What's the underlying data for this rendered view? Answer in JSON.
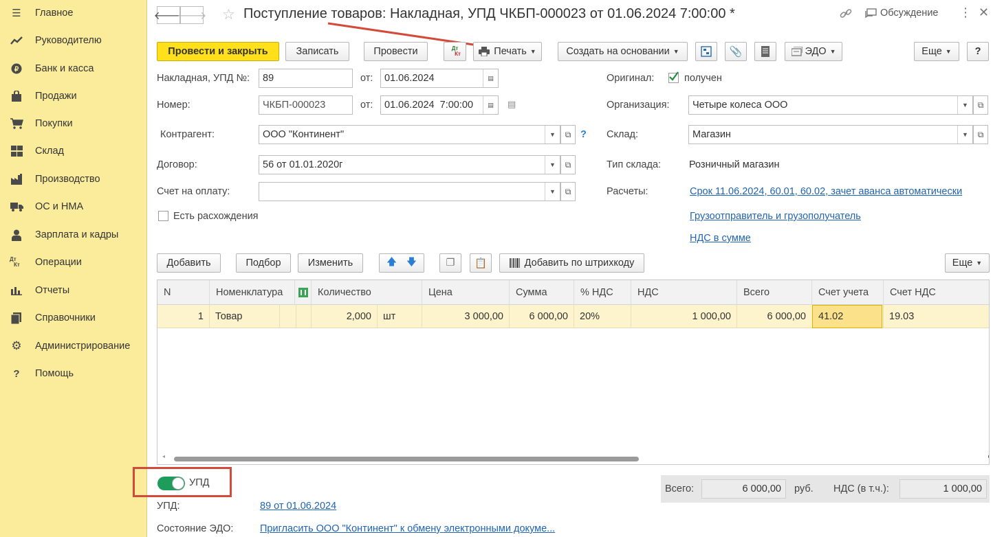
{
  "sidebar": {
    "items": [
      {
        "label": "Главное",
        "icon": "menu-icon"
      },
      {
        "label": "Руководителю",
        "icon": "trend-icon"
      },
      {
        "label": "Банк и касса",
        "icon": "coin-icon"
      },
      {
        "label": "Продажи",
        "icon": "bag-icon"
      },
      {
        "label": "Покупки",
        "icon": "cart-icon"
      },
      {
        "label": "Склад",
        "icon": "grid-icon"
      },
      {
        "label": "Производство",
        "icon": "factory-icon"
      },
      {
        "label": "ОС и НМА",
        "icon": "truck-icon"
      },
      {
        "label": "Зарплата и кадры",
        "icon": "person-icon"
      },
      {
        "label": "Операции",
        "icon": "dt-kt-icon"
      },
      {
        "label": "Отчеты",
        "icon": "bar-chart-icon"
      },
      {
        "label": "Справочники",
        "icon": "books-icon"
      },
      {
        "label": "Администрирование",
        "icon": "gear-icon"
      },
      {
        "label": "Помощь",
        "icon": "question-icon"
      }
    ]
  },
  "header": {
    "title": "Поступление товаров: Накладная, УПД ЧКБП-000023 от 01.06.2024 7:00:00 *",
    "discussion": "Обсуждение"
  },
  "toolbar": {
    "post_close": "Провести и закрыть",
    "save": "Записать",
    "post": "Провести",
    "dtkt": "Дт Кт",
    "print": "Печать",
    "create_based": "Создать на основании",
    "edo": "ЭДО",
    "more": "Еще",
    "help": "?"
  },
  "form": {
    "invoice_label": "Накладная, УПД №:",
    "invoice_no": "89",
    "from_label": "от:",
    "invoice_date": "01.06.2024",
    "number_label": "Номер:",
    "number": "ЧКБП-000023",
    "number_date": "01.06.2024  7:00:00",
    "counterparty_label": "Контрагент:",
    "counterparty": "ООО \"Континент\"",
    "contract_label": "Договор:",
    "contract": "56 от 01.01.2020г",
    "invoice_pay_label": "Счет на оплату:",
    "invoice_pay": "",
    "discrepancy_label": "Есть расхождения",
    "original_label": "Оригинал:",
    "original_value": "получен",
    "org_label": "Организация:",
    "org": "Четыре колеса ООО",
    "warehouse_label": "Склад:",
    "warehouse": "Магазин",
    "wh_type_label": "Тип склада:",
    "wh_type": "Розничный магазин",
    "settlements_label": "Расчеты:",
    "settlements_link": "Срок 11.06.2024, 60.01, 60.02, зачет аванса автоматически",
    "shipper_link": "Грузоотправитель и грузополучатель",
    "vat_link": "НДС в сумме"
  },
  "table_toolbar": {
    "add": "Добавить",
    "pick": "Подбор",
    "edit": "Изменить",
    "barcode": "Добавить по штрихкоду",
    "more": "Еще"
  },
  "table": {
    "headers": [
      "N",
      "Номенклатура",
      "Количество",
      "Цена",
      "Сумма",
      "% НДС",
      "НДС",
      "Всего",
      "Счет учета",
      "Счет НДС"
    ],
    "rows": [
      {
        "n": "1",
        "item": "Товар",
        "qty": "2,000",
        "unit": "шт",
        "price": "3 000,00",
        "sum": "6 000,00",
        "vat_rate": "20%",
        "vat": "1 000,00",
        "total": "6 000,00",
        "account": "41.02",
        "vat_account": "19.03"
      }
    ]
  },
  "footer": {
    "upd_toggle": "УПД",
    "total_label": "Всего:",
    "total": "6 000,00",
    "currency": "руб.",
    "vat_label": "НДС (в т.ч.):",
    "vat_total": "1 000,00",
    "upd_label": "УПД:",
    "upd_link": "89 от 01.06.2024",
    "edo_label": "Состояние ЭДО:",
    "edo_link": "Пригласить ООО \"Континент\" к обмену электронными докуме..."
  }
}
